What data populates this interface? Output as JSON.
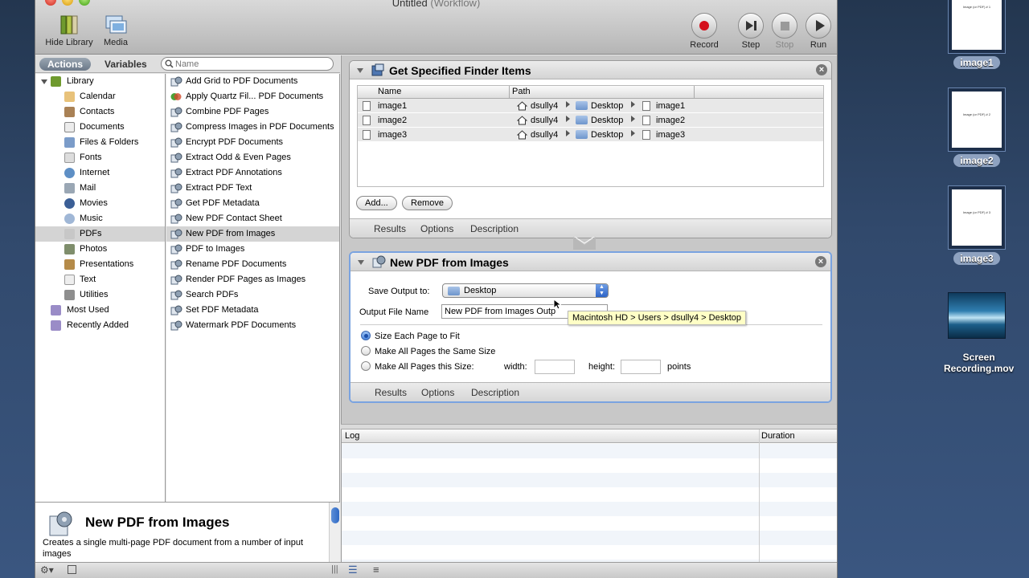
{
  "window": {
    "title": "Untitled",
    "subtitle": "(Workflow)"
  },
  "toolbar": {
    "hide_library": "Hide Library",
    "media": "Media",
    "record": "Record",
    "step": "Step",
    "stop": "Stop",
    "run": "Run"
  },
  "library": {
    "tab_actions": "Actions",
    "tab_variables": "Variables",
    "search_placeholder": "Name",
    "categories": [
      "Library",
      "Calendar",
      "Contacts",
      "Documents",
      "Files & Folders",
      "Fonts",
      "Internet",
      "Mail",
      "Movies",
      "Music",
      "PDFs",
      "Photos",
      "Presentations",
      "Text",
      "Utilities",
      "Most Used",
      "Recently Added"
    ],
    "selected_category": "PDFs",
    "actions": [
      "Add Grid to PDF Documents",
      "Apply Quartz Fil... PDF Documents",
      "Combine PDF Pages",
      "Compress Images in PDF Documents",
      "Encrypt PDF Documents",
      "Extract Odd & Even Pages",
      "Extract PDF Annotations",
      "Extract PDF Text",
      "Get PDF Metadata",
      "New PDF Contact Sheet",
      "New PDF from Images",
      "PDF to Images",
      "Rename PDF Documents",
      "Render PDF Pages as Images",
      "Search PDFs",
      "Set PDF Metadata",
      "Watermark PDF Documents"
    ],
    "selected_action": "New PDF from Images",
    "description_title": "New PDF from Images",
    "description_body": "Creates a single multi-page PDF document from a number of input images"
  },
  "action1": {
    "title": "Get Specified Finder Items",
    "col_name": "Name",
    "col_path": "Path",
    "rows": [
      {
        "name": "image1",
        "user": "dsully4",
        "folder": "Desktop",
        "file": "image1"
      },
      {
        "name": "image2",
        "user": "dsully4",
        "folder": "Desktop",
        "file": "image2"
      },
      {
        "name": "image3",
        "user": "dsully4",
        "folder": "Desktop",
        "file": "image3"
      }
    ],
    "add_button": "Add...",
    "remove_button": "Remove",
    "foot_results": "Results",
    "foot_options": "Options",
    "foot_description": "Description"
  },
  "action2": {
    "title": "New PDF from Images",
    "save_label": "Save Output to:",
    "save_value": "Desktop",
    "filename_label": "Output File Name",
    "filename_value": "New PDF from Images Outp",
    "tooltip": "Macintosh HD > Users > dsully4 > Desktop",
    "opt1": "Size Each Page to Fit",
    "opt2": "Make All Pages the Same Size",
    "opt3": "Make All Pages this Size:",
    "width_label": "width:",
    "height_label": "height:",
    "points_label": "points",
    "foot_results": "Results",
    "foot_options": "Options",
    "foot_description": "Description"
  },
  "log": {
    "col_log": "Log",
    "col_duration": "Duration"
  },
  "desktop": {
    "icons": [
      {
        "label": "image1",
        "thumb_text": "Image (or PDF) # 1"
      },
      {
        "label": "image2",
        "thumb_text": "Image (or PDF) # 2"
      },
      {
        "label": "image3",
        "thumb_text": "Image (or PDF) # 3"
      }
    ],
    "movie_label_1": "Screen",
    "movie_label_2": "Recording.mov"
  }
}
